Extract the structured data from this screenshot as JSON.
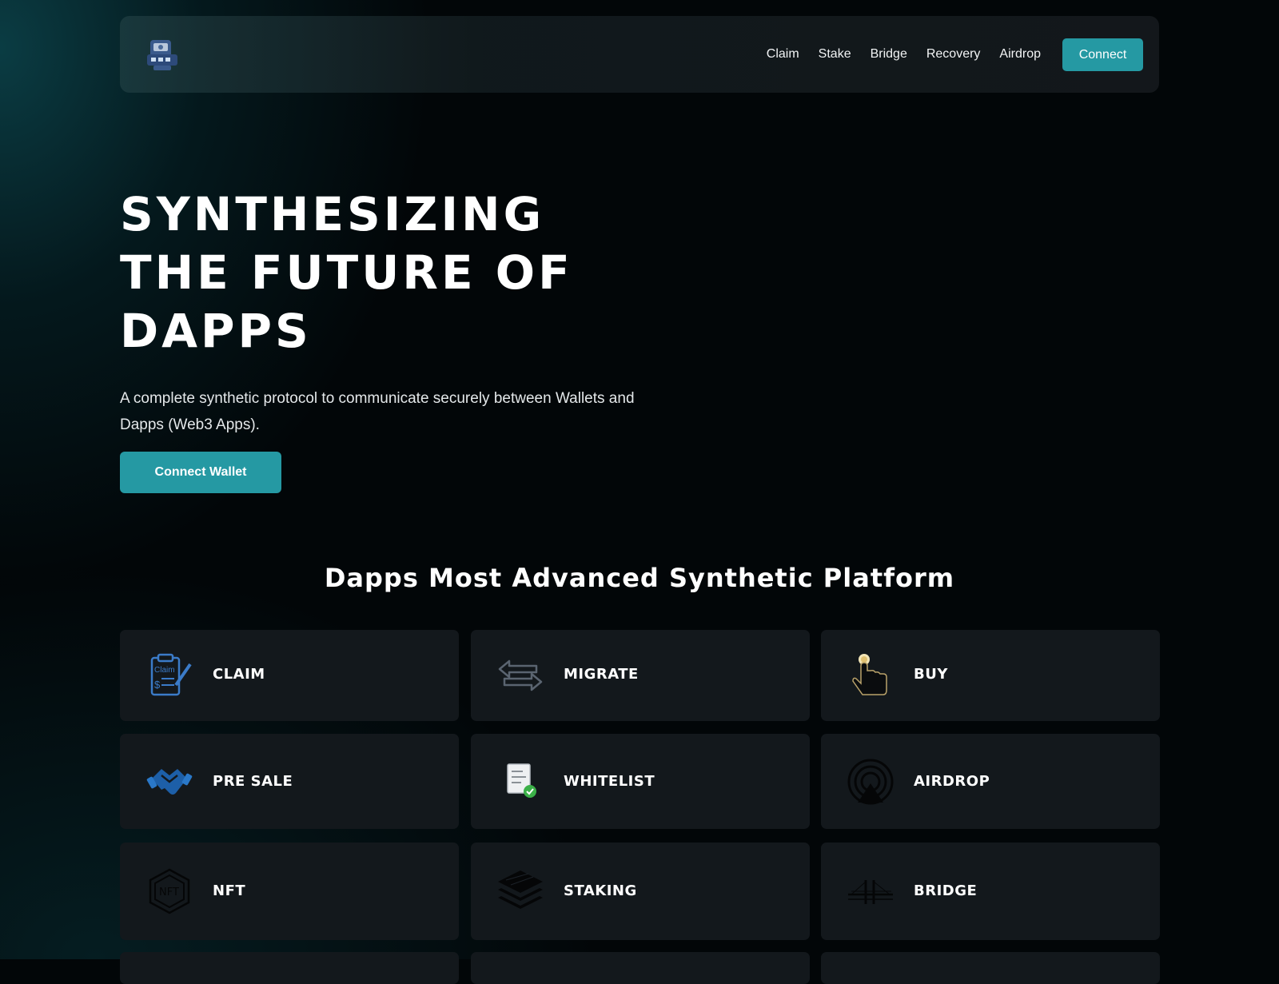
{
  "nav": {
    "logo_name": "robot-logo",
    "links": [
      "Claim",
      "Stake",
      "Bridge",
      "Recovery",
      "Airdrop"
    ],
    "connect_label": "Connect"
  },
  "hero": {
    "title_lines": [
      "SYNTHESIZING",
      "THE FUTURE OF",
      "DAPPS"
    ],
    "subtitle": "A complete synthetic protocol to communicate securely between Wallets and Dapps (Web3 Apps).",
    "cta_label": "Connect Wallet"
  },
  "features": {
    "title": "Dapps Most Advanced Synthetic Platform",
    "cards": [
      {
        "label": "CLAIM",
        "icon": "claim-clipboard-icon"
      },
      {
        "label": "MIGRATE",
        "icon": "migrate-arrows-icon"
      },
      {
        "label": "BUY",
        "icon": "tap-hand-icon"
      },
      {
        "label": "PRE SALE",
        "icon": "handshake-icon"
      },
      {
        "label": "WHITELIST",
        "icon": "checked-document-icon"
      },
      {
        "label": "AIRDROP",
        "icon": "broadcast-icon"
      },
      {
        "label": "NFT",
        "icon": "nft-hexagon-icon"
      },
      {
        "label": "STAKING",
        "icon": "stacked-layers-icon"
      },
      {
        "label": "BRIDGE",
        "icon": "bridge-icon"
      }
    ]
  },
  "colors": {
    "accent": "#2599a3",
    "card_bg": "#13181c",
    "background": "#020608"
  }
}
